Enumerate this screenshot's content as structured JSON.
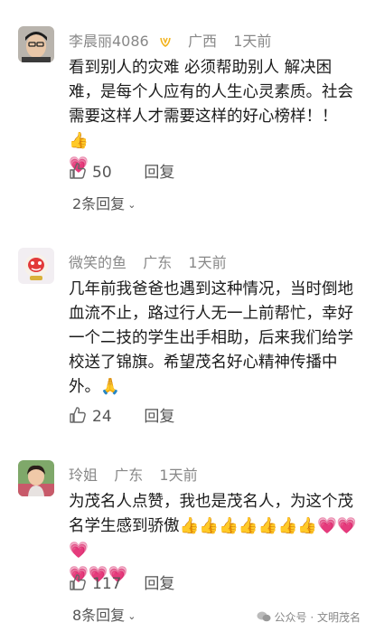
{
  "comments": [
    {
      "user": "李晨丽4086",
      "location": "广西",
      "time": "1天前",
      "text_lines": [
        "看到别人的灾难 必须帮助别人 解决困",
        "难，是每个人应有的人生心灵素质。社会",
        "需要这样人才需要这样的好心榜样！！ 👍",
        "💗"
      ],
      "likes": "50",
      "reply_label": "回复",
      "more_replies": "2条回复"
    },
    {
      "user": "微笑的鱼",
      "location": "广东",
      "time": "1天前",
      "text_lines": [
        "几年前我爸爸也遇到这种情况，当时倒地",
        "血流不止，路过行人无一上前帮忙，幸好",
        "一个二技的学生出手相助，后来我们给学",
        "校送了锦旗。希望茂名好心精神传播中",
        "外。🙏"
      ],
      "likes": "24",
      "reply_label": "回复"
    },
    {
      "user": "玲姐",
      "location": "广东",
      "time": "1天前",
      "text_lines": [
        "为茂名人点赞，我也是茂名人，为这个茂",
        "名学生感到骄傲👍👍👍👍👍👍👍💗💗💗",
        "💗💗💗"
      ],
      "likes": "117",
      "reply_label": "回复",
      "more_replies": "8条回复"
    }
  ],
  "watermark": "公众号 · 文明茂名",
  "colors": {
    "meta": "#888888",
    "text": "#1b1b1b",
    "heart": "#ff4f74"
  }
}
